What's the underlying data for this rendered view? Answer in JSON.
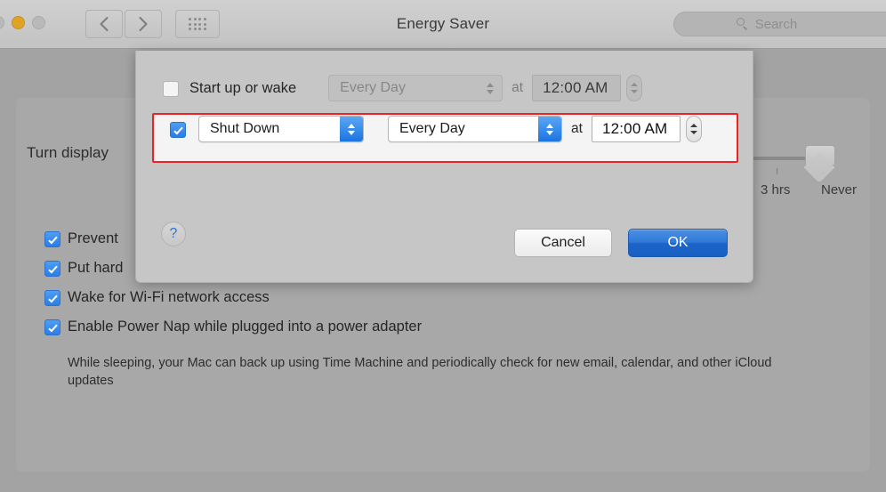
{
  "window": {
    "title": "Energy Saver",
    "traffic_lights": [
      "close",
      "minimize",
      "zoom"
    ],
    "nav": {
      "back_label": "Back",
      "forward_label": "Forward",
      "grid_label": "Show All"
    },
    "search": {
      "placeholder": "Search",
      "value": ""
    }
  },
  "main": {
    "turn_display_label": "Turn display",
    "slider": {
      "left_label": "3 hrs",
      "right_label": "Never",
      "value": "Never"
    },
    "options": [
      {
        "label": "Prevent",
        "checked": true
      },
      {
        "label": "Put hard",
        "checked": true
      },
      {
        "label": "Wake for Wi-Fi network access",
        "checked": true
      },
      {
        "label": "Enable Power Nap while plugged into a power adapter",
        "checked": true
      }
    ],
    "power_nap_description": "While sleeping, your Mac can back up using Time Machine and periodically check for new email, calendar, and other iCloud updates"
  },
  "sheet": {
    "rows": [
      {
        "id": "startup",
        "enabled": false,
        "checked": false,
        "checkbox_label": "Start up or wake",
        "action": null,
        "repeat": "Every Day",
        "at_label": "at",
        "time": "12:00 AM"
      },
      {
        "id": "action",
        "enabled": true,
        "checked": true,
        "checkbox_label": "",
        "action": "Shut Down",
        "repeat": "Every Day",
        "at_label": "at",
        "time": "12:00 AM"
      }
    ],
    "help_label": "?",
    "cancel_label": "Cancel",
    "ok_label": "OK"
  },
  "colors": {
    "accent_blue": "#2b7de8",
    "highlight_red": "#ee2222",
    "ok_button_blue": "#2f78d6",
    "window_bg": "#a3a3a3"
  }
}
